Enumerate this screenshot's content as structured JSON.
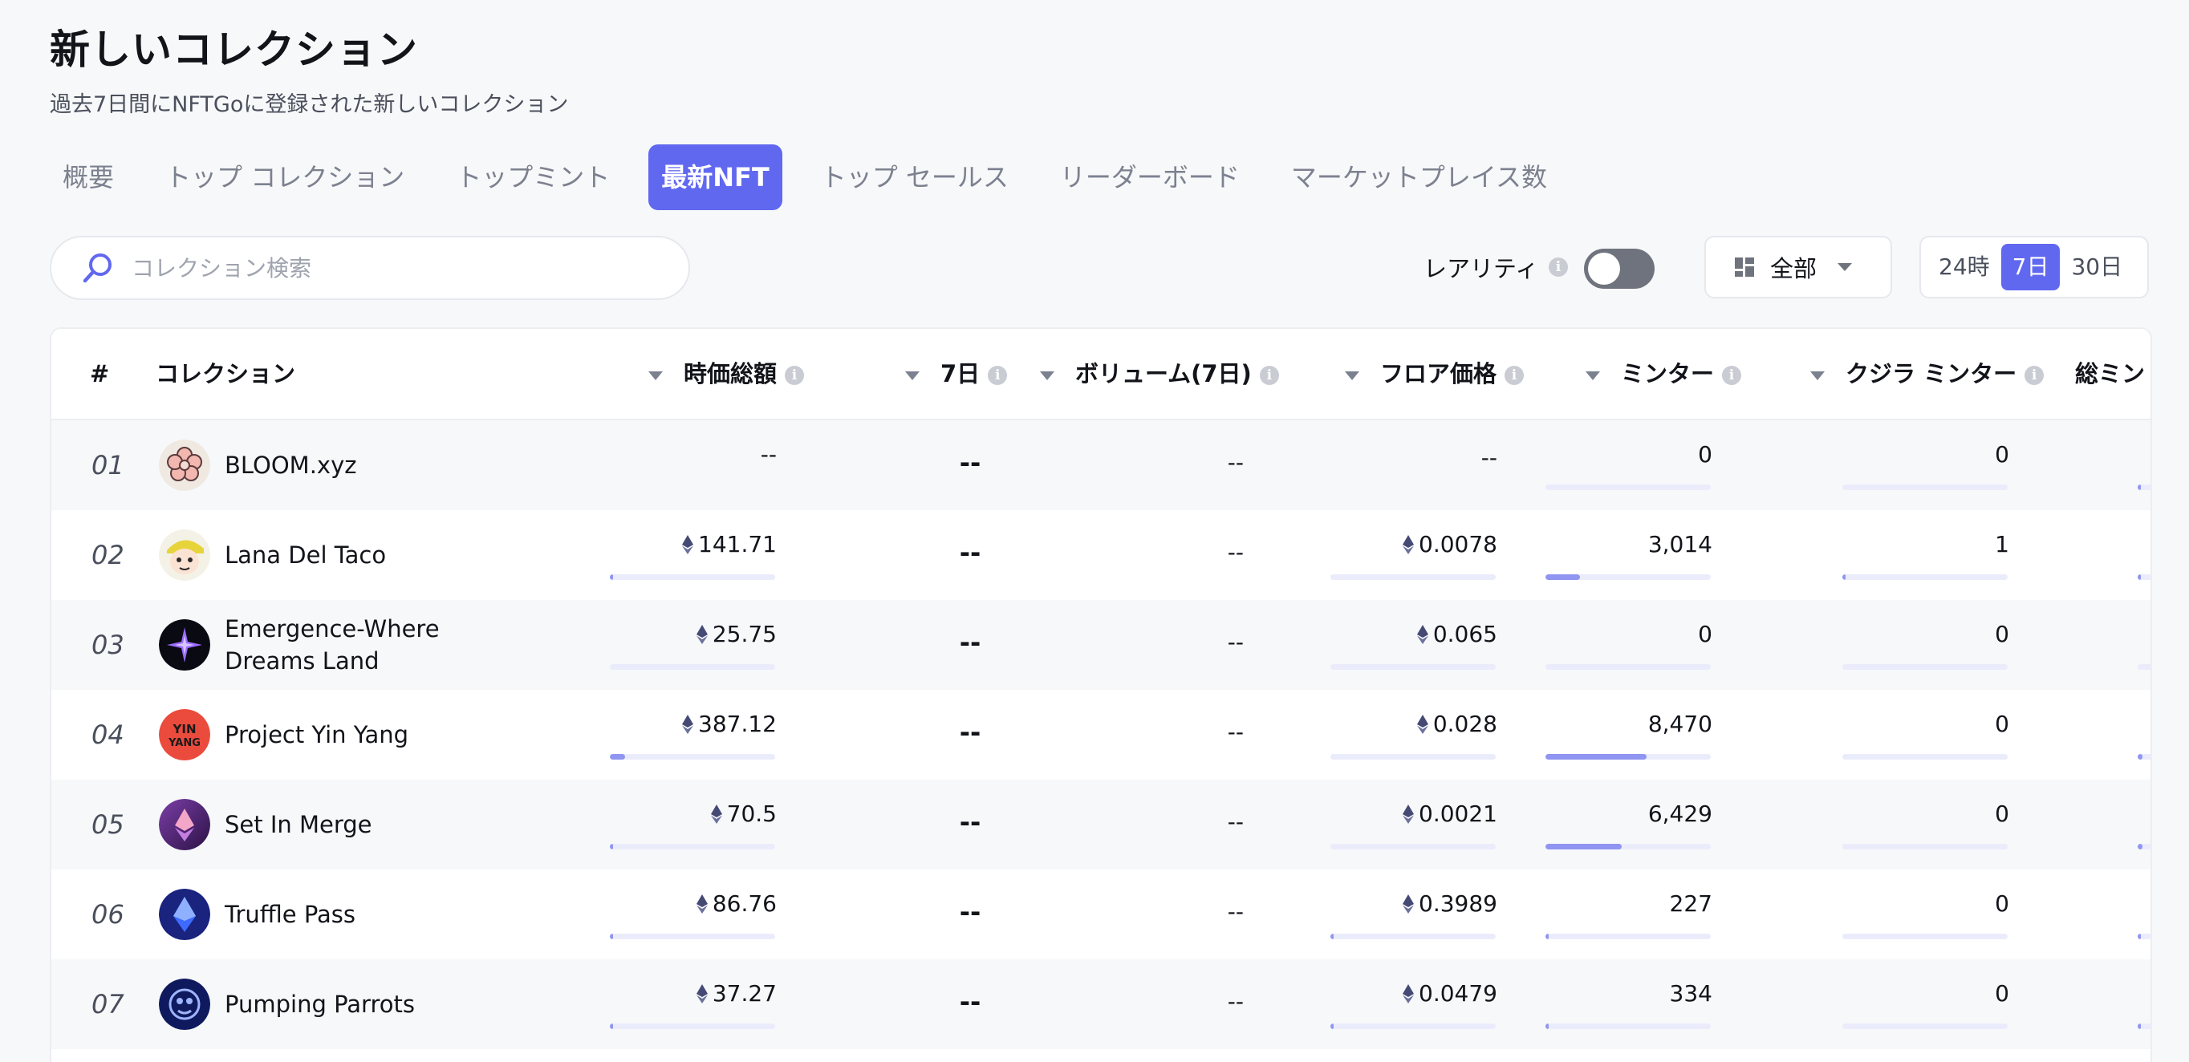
{
  "header": {
    "title": "新しいコレクション",
    "subtitle": "過去7日間にNFTGoに登録された新しいコレクション"
  },
  "tabs": [
    {
      "label": "概要",
      "active": false
    },
    {
      "label": "トップ コレクション",
      "active": false
    },
    {
      "label": "トップミント",
      "active": false
    },
    {
      "label": "最新NFT",
      "active": true
    },
    {
      "label": "トップ セールス",
      "active": false
    },
    {
      "label": "リーダーボード",
      "active": false
    },
    {
      "label": "マーケットプレイス数",
      "active": false
    }
  ],
  "search": {
    "placeholder": "コレクション検索",
    "value": ""
  },
  "rarity": {
    "label": "レアリティ",
    "enabled": false,
    "info_icon": "i"
  },
  "filter": {
    "label": "全部",
    "icon": "grid-icon"
  },
  "time_range": {
    "options": [
      "24時",
      "7日",
      "30日"
    ],
    "selected": "7日"
  },
  "colors": {
    "accent": "#6168f0",
    "bar_track": "#ebecfb",
    "bar_fill": "#8f95f1"
  },
  "table": {
    "columns": {
      "rank": "#",
      "collection": "コレクション",
      "market_cap": "時価総額",
      "change_7d": "7日",
      "volume_7d": "ボリューム(7日)",
      "floor_price": "フロア価格",
      "minters": "ミンター",
      "whale_minters": "クジラ ミンター",
      "total_mints": "総ミント"
    },
    "rows": [
      {
        "rank": "01",
        "name": "BLOOM.xyz",
        "avatar": "flower-avatar",
        "market_cap": "--",
        "market_cap_eth": false,
        "market_cap_bar": 0,
        "change_7d": "--",
        "volume_7d": "--",
        "floor_price": "--",
        "floor_eth": false,
        "floor_bar": 0,
        "minters": "0",
        "minters_bar": 0,
        "whale_minters": "0",
        "whale_bar": 0,
        "total_bar": 0.02
      },
      {
        "rank": "02",
        "name": "Lana Del Taco",
        "avatar": "cartoon-avatar",
        "market_cap": "141.71",
        "market_cap_eth": true,
        "market_cap_bar": 0.02,
        "change_7d": "--",
        "volume_7d": "--",
        "floor_price": "0.0078",
        "floor_eth": true,
        "floor_bar": 0,
        "minters": "3,014",
        "minters_bar": 0.21,
        "whale_minters": "1",
        "whale_bar": 0.02,
        "total_bar": 0.02
      },
      {
        "rank": "03",
        "name": "Emergence-Where Dreams Land",
        "avatar": "star-avatar",
        "market_cap": "25.75",
        "market_cap_eth": true,
        "market_cap_bar": 0,
        "change_7d": "--",
        "volume_7d": "--",
        "floor_price": "0.065",
        "floor_eth": true,
        "floor_bar": 0,
        "minters": "0",
        "minters_bar": 0,
        "whale_minters": "0",
        "whale_bar": 0,
        "total_bar": 0
      },
      {
        "rank": "04",
        "name": "Project Yin Yang",
        "avatar": "yinyang-avatar",
        "market_cap": "387.12",
        "market_cap_eth": true,
        "market_cap_bar": 0.09,
        "change_7d": "--",
        "volume_7d": "--",
        "floor_price": "0.028",
        "floor_eth": true,
        "floor_bar": 0,
        "minters": "8,470",
        "minters_bar": 0.61,
        "whale_minters": "0",
        "whale_bar": 0,
        "total_bar": 0.03
      },
      {
        "rank": "05",
        "name": "Set In Merge",
        "avatar": "eth-avatar",
        "market_cap": "70.5",
        "market_cap_eth": true,
        "market_cap_bar": 0.02,
        "change_7d": "--",
        "volume_7d": "--",
        "floor_price": "0.0021",
        "floor_eth": true,
        "floor_bar": 0,
        "minters": "6,429",
        "minters_bar": 0.46,
        "whale_minters": "0",
        "whale_bar": 0,
        "total_bar": 0.03
      },
      {
        "rank": "06",
        "name": "Truffle Pass",
        "avatar": "crystal-avatar",
        "market_cap": "86.76",
        "market_cap_eth": true,
        "market_cap_bar": 0.02,
        "change_7d": "--",
        "volume_7d": "--",
        "floor_price": "0.3989",
        "floor_eth": true,
        "floor_bar": 0.02,
        "minters": "227",
        "minters_bar": 0.02,
        "whale_minters": "0",
        "whale_bar": 0,
        "total_bar": 0.02
      },
      {
        "rank": "07",
        "name": "Pumping Parrots",
        "avatar": "parrot-avatar",
        "market_cap": "37.27",
        "market_cap_eth": true,
        "market_cap_bar": 0.02,
        "change_7d": "--",
        "volume_7d": "--",
        "floor_price": "0.0479",
        "floor_eth": true,
        "floor_bar": 0.02,
        "minters": "334",
        "minters_bar": 0.02,
        "whale_minters": "0",
        "whale_bar": 0,
        "total_bar": 0.02
      }
    ]
  }
}
